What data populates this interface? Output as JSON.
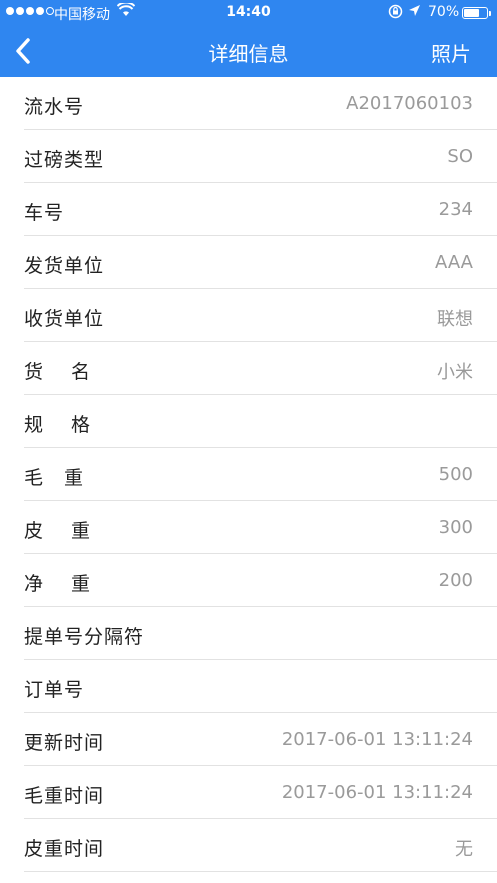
{
  "status_bar": {
    "carrier": "中国移动",
    "time": "14:40",
    "battery_percent": "70%",
    "battery_level": 0.7
  },
  "nav": {
    "back_icon": "chevron-left-icon",
    "title": "详细信息",
    "photo_label": "照片"
  },
  "rows": [
    {
      "label": "流水号",
      "value": "A2017060103"
    },
    {
      "label": "过磅类型",
      "value": "SO"
    },
    {
      "label": "车号",
      "value": "234"
    },
    {
      "label": "发货单位",
      "value": "AAA"
    },
    {
      "label": "收货单位",
      "value": "联想"
    },
    {
      "label": "货　 名",
      "value": "小米"
    },
    {
      "label": "规　 格",
      "value": ""
    },
    {
      "label": "毛　重",
      "value": "500"
    },
    {
      "label": "皮　 重",
      "value": "300"
    },
    {
      "label": "净　 重",
      "value": "200"
    },
    {
      "label": "提单号分隔符",
      "value": ""
    },
    {
      "label": "订单号",
      "value": ""
    },
    {
      "label": "更新时间",
      "value": "2017-06-01 13:11:24"
    },
    {
      "label": "毛重时间",
      "value": "2017-06-01 13:11:24"
    },
    {
      "label": "皮重时间",
      "value": "无"
    }
  ],
  "colors": {
    "header": "#2f86f0",
    "value_text": "#9a9a9a",
    "divider": "#e2e2e2"
  }
}
